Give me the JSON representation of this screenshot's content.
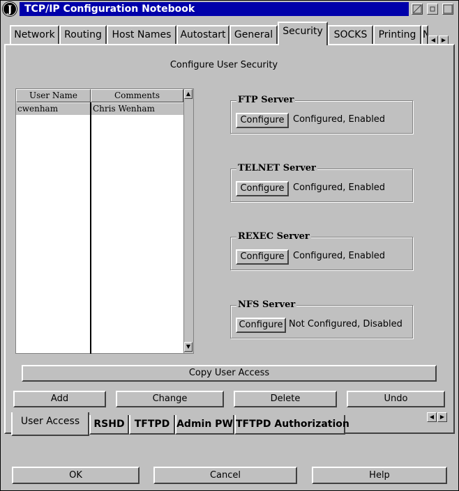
{
  "window": {
    "title": "TCP/IP Configuration Notebook",
    "system_icon_letter": "J",
    "title_color": "#0000aa"
  },
  "top_tabs": [
    "Network",
    "Routing",
    "Host Names",
    "Autostart",
    "General",
    "Security",
    "SOCKS",
    "Printing",
    "N"
  ],
  "active_top_tab": "Security",
  "page_heading": "Configure User Security",
  "user_list": {
    "columns": [
      "User Name",
      "Comments"
    ],
    "rows": [
      {
        "user_name": "cwenham",
        "comments": "Chris Wenham"
      }
    ]
  },
  "servers": [
    {
      "title": "FTP Server",
      "button": "Configure",
      "status": "Configured, Enabled"
    },
    {
      "title": "TELNET Server",
      "button": "Configure",
      "status": "Configured, Enabled"
    },
    {
      "title": "REXEC Server",
      "button": "Configure",
      "status": "Configured, Enabled"
    },
    {
      "title": "NFS Server",
      "button": "Configure",
      "status": "Not Configured, Disabled"
    }
  ],
  "copy_button": "Copy User Access",
  "actions": {
    "add": "Add",
    "change": "Change",
    "delete": "Delete",
    "undo": "Undo"
  },
  "bottom_tabs": [
    "User Access",
    "RSHD",
    "TFTPD",
    "Admin PW",
    "TFTPD Authorization"
  ],
  "active_bottom_tab": "User Access",
  "dialog_buttons": {
    "ok": "OK",
    "cancel": "Cancel",
    "help": "Help"
  }
}
